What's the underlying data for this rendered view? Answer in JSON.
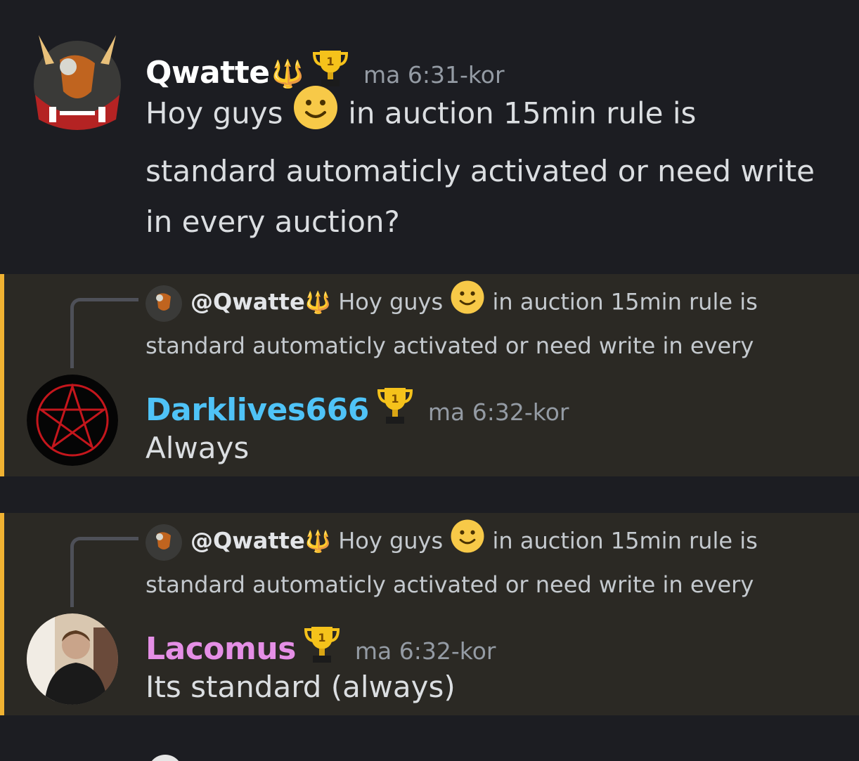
{
  "messages": [
    {
      "username": "Qwatte",
      "username_color": "#ffffff",
      "trident": "🔱",
      "timestamp": "ma 6:31-kor",
      "content_parts": [
        "Hoy guys ",
        "in auction 15min rule is standard automaticly activated or need write in every auction?"
      ],
      "badge_icon": "trophy-icon"
    },
    {
      "reply": {
        "author": "@Qwatte",
        "text_before_emoji": "Hoy guys ",
        "text_after_emoji": "in auction 15min rule is standard automaticly activated or need write in every"
      },
      "username": "Darklives666",
      "username_color": "#4fc3f7",
      "timestamp": "ma 6:32-kor",
      "content": "Always",
      "badge_icon": "trophy-icon"
    },
    {
      "reply": {
        "author": "@Qwatte",
        "text_before_emoji": "Hoy guys ",
        "text_after_emoji": "in auction 15min rule is standard automaticly activated or need write in every"
      },
      "username": "Lacomus",
      "username_color": "#e58fe6",
      "timestamp": "ma 6:32-kor",
      "content": "Its standard (always)",
      "badge_icon": "trophy-icon"
    }
  ],
  "colors": {
    "background": "#1c1d22",
    "mention_highlight": "#2b2924",
    "mention_bar": "#f0b232",
    "timestamp": "#949ba4"
  }
}
